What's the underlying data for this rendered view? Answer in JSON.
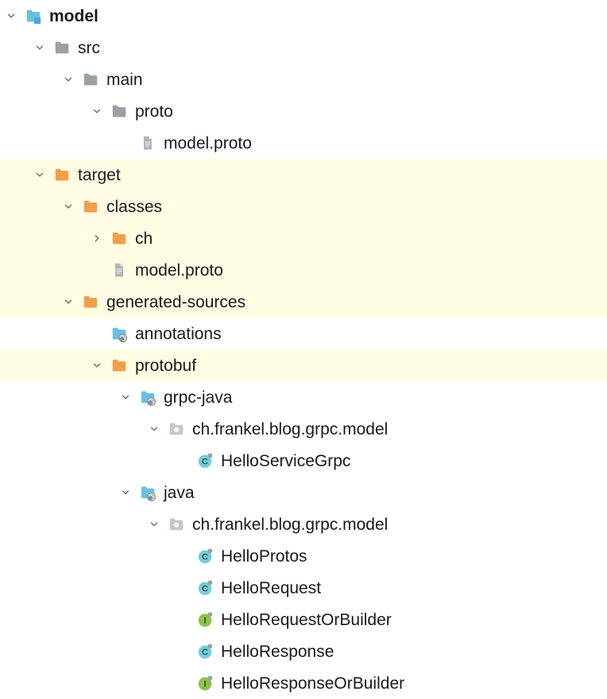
{
  "colors": {
    "highlight": "#fffce3",
    "folderGray": "#9aa0a6",
    "folderOrange": "#f0a04c",
    "folderBlue": "#66c2e0",
    "fileGray": "#b0b4b9",
    "classBg": "#78cdd8",
    "interfaceBg": "#8bc34a",
    "arrow": "#6b6f76"
  },
  "tree": [
    {
      "indent": 0,
      "arrow": "down",
      "icon": "module-folder",
      "label": "model",
      "bold": true,
      "highlight": false
    },
    {
      "indent": 1,
      "arrow": "down",
      "icon": "folder-gray",
      "label": "src",
      "highlight": false
    },
    {
      "indent": 2,
      "arrow": "down",
      "icon": "folder-gray",
      "label": "main",
      "highlight": false
    },
    {
      "indent": 3,
      "arrow": "down",
      "icon": "folder-gray",
      "label": "proto",
      "highlight": false
    },
    {
      "indent": 4,
      "arrow": "none",
      "icon": "file",
      "label": "model.proto",
      "highlight": false
    },
    {
      "indent": 1,
      "arrow": "down",
      "icon": "folder-orange",
      "label": "target",
      "highlight": true
    },
    {
      "indent": 2,
      "arrow": "down",
      "icon": "folder-orange",
      "label": "classes",
      "highlight": true
    },
    {
      "indent": 3,
      "arrow": "right",
      "icon": "folder-orange",
      "label": "ch",
      "highlight": true
    },
    {
      "indent": 3,
      "arrow": "none",
      "icon": "file",
      "label": "model.proto",
      "highlight": true
    },
    {
      "indent": 2,
      "arrow": "down",
      "icon": "folder-orange",
      "label": "generated-sources",
      "highlight": true
    },
    {
      "indent": 3,
      "arrow": "none",
      "icon": "gen-folder",
      "label": "annotations",
      "highlight": false
    },
    {
      "indent": 3,
      "arrow": "down",
      "icon": "folder-orange",
      "label": "protobuf",
      "highlight": true
    },
    {
      "indent": 4,
      "arrow": "down",
      "icon": "gen-folder",
      "label": "grpc-java",
      "highlight": false
    },
    {
      "indent": 5,
      "arrow": "down",
      "icon": "package",
      "label": "ch.frankel.blog.grpc.model",
      "highlight": false
    },
    {
      "indent": 6,
      "arrow": "none",
      "icon": "class",
      "label": "HelloServiceGrpc",
      "highlight": false
    },
    {
      "indent": 4,
      "arrow": "down",
      "icon": "gen-folder",
      "label": "java",
      "highlight": false
    },
    {
      "indent": 5,
      "arrow": "down",
      "icon": "package",
      "label": "ch.frankel.blog.grpc.model",
      "highlight": false
    },
    {
      "indent": 6,
      "arrow": "none",
      "icon": "class",
      "label": "HelloProtos",
      "highlight": false
    },
    {
      "indent": 6,
      "arrow": "none",
      "icon": "class",
      "label": "HelloRequest",
      "highlight": false
    },
    {
      "indent": 6,
      "arrow": "none",
      "icon": "interface",
      "label": "HelloRequestOrBuilder",
      "highlight": false
    },
    {
      "indent": 6,
      "arrow": "none",
      "icon": "class",
      "label": "HelloResponse",
      "highlight": false
    },
    {
      "indent": 6,
      "arrow": "none",
      "icon": "interface",
      "label": "HelloResponseOrBuilder",
      "highlight": false
    }
  ]
}
